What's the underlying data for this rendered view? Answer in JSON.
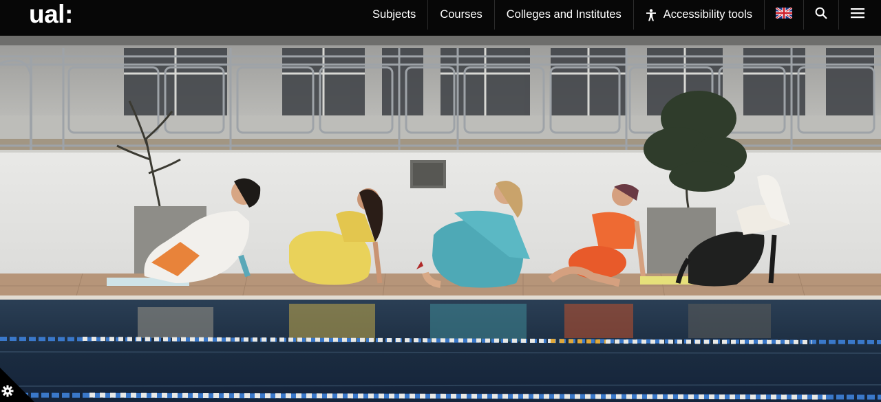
{
  "brand": {
    "logo_text": "ual:"
  },
  "nav": {
    "subjects": "Subjects",
    "courses": "Courses",
    "colleges": "Colleges and Institutes",
    "accessibility": "Accessibility tools"
  },
  "icons": {
    "accessibility": "accessibility-person-icon",
    "language": "uk-flag-icon",
    "search": "search-icon",
    "menu": "hamburger-menu-icon",
    "cookie_settings": "gear-icon"
  },
  "colors": {
    "header_bg": "#070707",
    "header_text": "#ffffff",
    "pool_water": "#1d2f45",
    "wall": "#e4e4e2",
    "deck": "#b69579"
  },
  "hero": {
    "image_alt": "Five performers in sculptural inflatable costumes pose beside an outdoor swimming pool"
  }
}
